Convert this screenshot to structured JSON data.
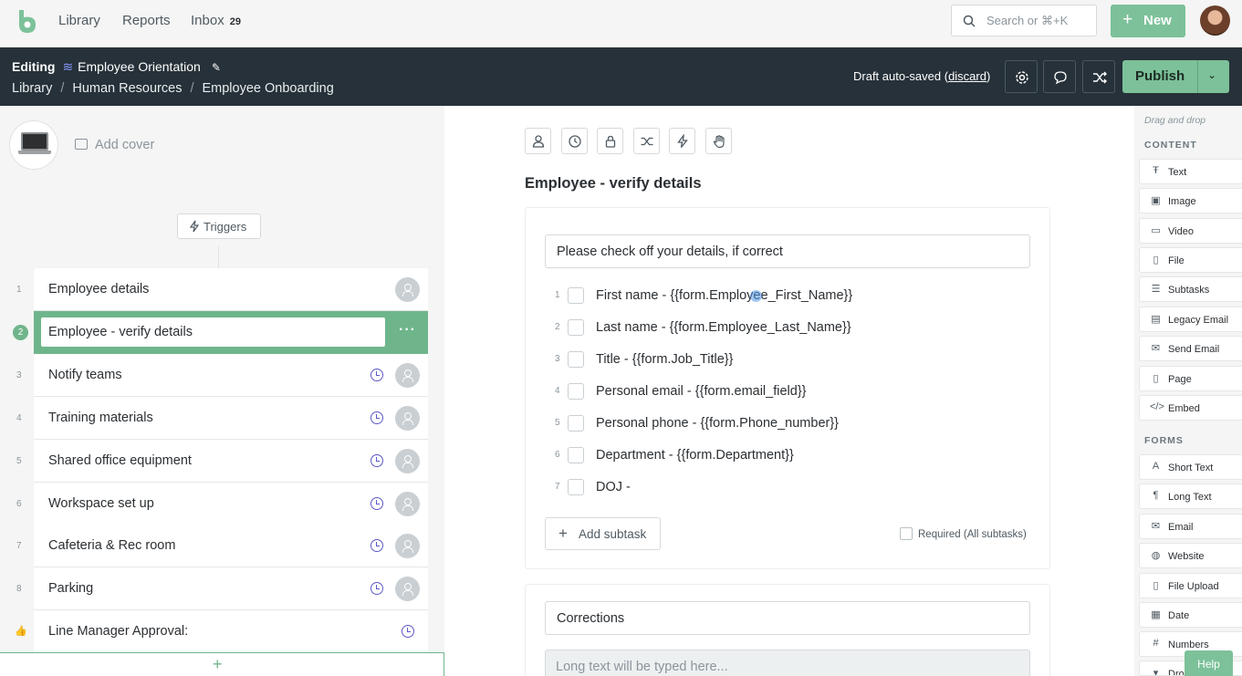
{
  "nav": {
    "links": [
      "Library",
      "Reports",
      "Inbox"
    ],
    "inbox_count": "29",
    "search_placeholder": "Search or ⌘+K",
    "new_label": "New"
  },
  "editbar": {
    "mode": "Editing",
    "workflow_name": "Employee Orientation",
    "breadcrumb": [
      "Library",
      "Human Resources",
      "Employee Onboarding"
    ],
    "draft_text": "Draft auto-saved",
    "discard_label": "discard",
    "publish_label": "Publish"
  },
  "left": {
    "add_cover": "Add cover",
    "triggers": "Triggers",
    "tasks": [
      {
        "num": "1",
        "name": "Employee details",
        "clock": false,
        "assignee": true
      },
      {
        "num": "2",
        "name": "Employee - verify details",
        "active": true
      },
      {
        "num": "3",
        "name": "Notify teams",
        "clock": true,
        "assignee": true
      },
      {
        "num": "4",
        "name": "Training materials",
        "clock": true,
        "assignee": true
      },
      {
        "num": "5",
        "name": "Shared office equipment",
        "clock": true,
        "assignee": true
      },
      {
        "num": "6",
        "name": "Workspace set up",
        "clock": true,
        "assignee": true
      },
      {
        "num": "7",
        "name": "Cafeteria & Rec room",
        "clock": true,
        "assignee": true
      },
      {
        "num": "8",
        "name": "Parking",
        "clock": true,
        "assignee": true
      },
      {
        "num": "",
        "name": "Line Manager Approval:",
        "clock": true,
        "assignee": false
      }
    ]
  },
  "center": {
    "step_title": "Employee - verify details",
    "subtask_header": "Please check off your details, if correct",
    "subtasks": [
      {
        "num": "1",
        "text": "First name - {{form.Employee_First_Name}}"
      },
      {
        "num": "2",
        "text": "Last name - {{form.Employee_Last_Name}}"
      },
      {
        "num": "3",
        "text": "Title - {{form.Job_Title}}"
      },
      {
        "num": "4",
        "text": "Personal email - {{form.email_field}}"
      },
      {
        "num": "5",
        "text": "Personal phone - {{form.Phone_number}}"
      },
      {
        "num": "6",
        "text": "Department - {{form.Department}}"
      },
      {
        "num": "7",
        "text": "DOJ -"
      }
    ],
    "add_subtask": "Add subtask",
    "required_label": "Required (All subtasks)",
    "corrections_label": "Corrections",
    "longtext_placeholder": "Long text will be typed here..."
  },
  "right": {
    "hint": "Drag and drop",
    "content_title": "CONTENT",
    "content_items": [
      "Text",
      "Image",
      "Video",
      "File",
      "Subtasks",
      "Legacy Email",
      "Send Email",
      "Page",
      "Embed"
    ],
    "forms_title": "FORMS",
    "form_items": [
      "Short Text",
      "Long Text",
      "Email",
      "Website",
      "File Upload",
      "Date",
      "Numbers",
      "Dro"
    ],
    "help": "Help"
  },
  "colors": {
    "accent_green": "#7cc19a",
    "active_green": "#6fb58b",
    "dark_bar": "#263139",
    "clock_purple": "#5b57c7"
  }
}
